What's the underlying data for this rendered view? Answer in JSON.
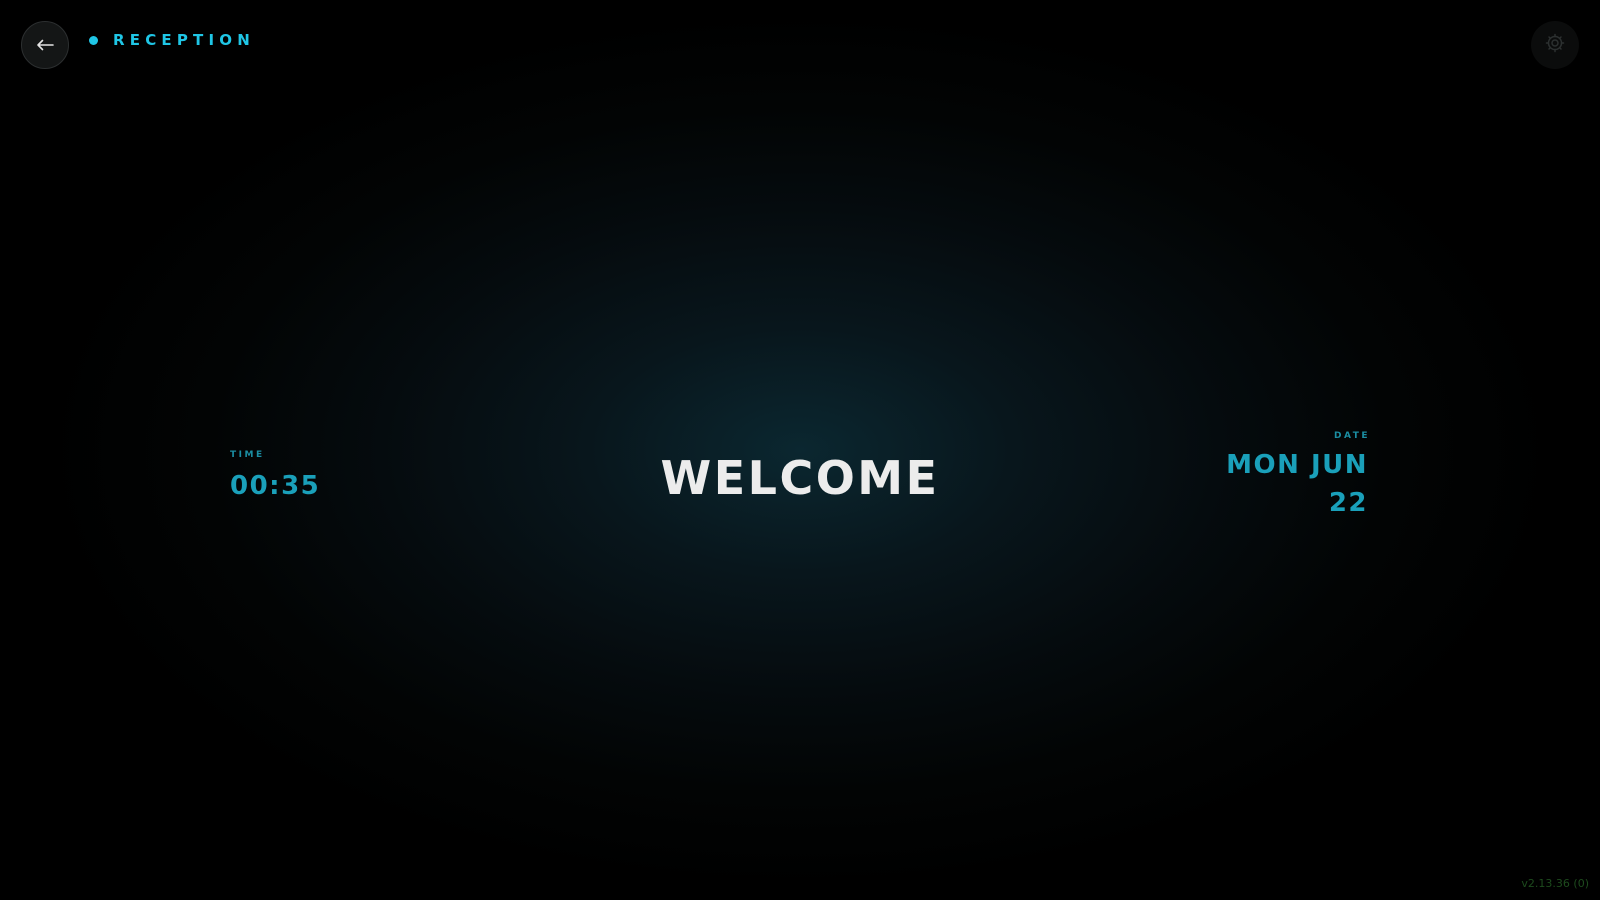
{
  "header": {
    "back_icon": "arrow-left-icon",
    "location_name": "RECEPTION",
    "status_color": "#1fc6e6",
    "settings_icon": "gear-icon"
  },
  "clock": {
    "time_label": "TIME",
    "time": "00:35",
    "date_label": "DATE",
    "date": "MON JUN 22"
  },
  "main": {
    "greeting": "WELCOME"
  },
  "footer": {
    "version": "v2.13.36 (0)"
  },
  "colors": {
    "accent": "#1fc6e6",
    "value_text": "#1aa0ba",
    "greeting_text": "#ececec",
    "background": "#000000"
  }
}
